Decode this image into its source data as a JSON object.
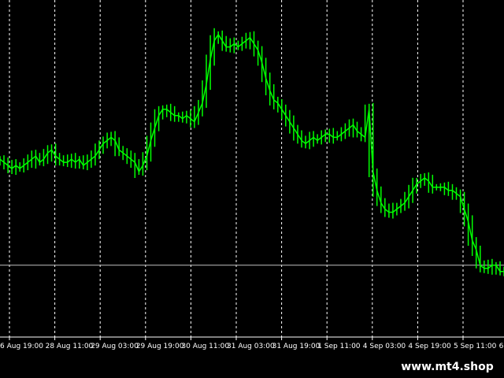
{
  "chart_data": {
    "type": "line",
    "grid": true,
    "ylim": [
      0,
      100
    ],
    "categories": [
      "6 Aug 19:00",
      "28 Aug 11:00",
      "29 Aug 03:00",
      "29 Aug 19:00",
      "30 Aug 11:00",
      "31 Aug 03:00",
      "31 Aug 19:00",
      "1 Sep 11:00",
      "4 Sep 03:00",
      "4 Sep 19:00",
      "5 Sep 11:00",
      "6 S"
    ],
    "series": [
      {
        "color": "#00ff00",
        "values": [
          54,
          53,
          52,
          51,
          52,
          51,
          52,
          53,
          54,
          55,
          53,
          54,
          56,
          57,
          55,
          54,
          53,
          53,
          54,
          53,
          54,
          52,
          53,
          54,
          55,
          57,
          59,
          60,
          61,
          60,
          57,
          56,
          55,
          54,
          53,
          50,
          52,
          55,
          60,
          64,
          68,
          70,
          70,
          69,
          68,
          68,
          67,
          68,
          67,
          66,
          69,
          72,
          78,
          86,
          92,
          94,
          92,
          90,
          90,
          91,
          90,
          91,
          92,
          93,
          91,
          89,
          85,
          80,
          76,
          73,
          72,
          70,
          68,
          66,
          64,
          62,
          60,
          59,
          60,
          61,
          60,
          61,
          62,
          62,
          61,
          61,
          62,
          63,
          64,
          65,
          63,
          62,
          61,
          70,
          50,
          44,
          40,
          38,
          37,
          37,
          38,
          39,
          40,
          42,
          44,
          46,
          47,
          48,
          47,
          45,
          45,
          45,
          45,
          44,
          44,
          43,
          42,
          38,
          34,
          28,
          25,
          20,
          19,
          19,
          20,
          20,
          18,
          18
        ]
      }
    ],
    "reference_lines": [
      {
        "value": 20,
        "color": "#c0c0c0"
      }
    ]
  },
  "watermark": {
    "text": "www.mt4.shop"
  }
}
